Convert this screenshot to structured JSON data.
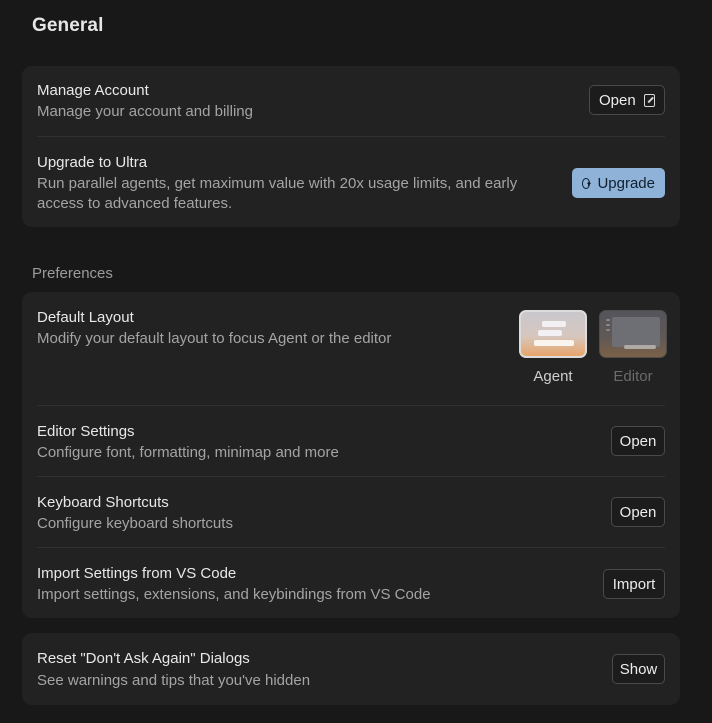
{
  "page_title": "General",
  "account": {
    "manage": {
      "title": "Manage Account",
      "description": "Manage your account and billing",
      "button_label": "Open",
      "button_icon": "external-link-icon"
    },
    "upgrade": {
      "title": "Upgrade to Ultra",
      "description": "Run parallel agents, get maximum value with 20x usage limits, and early access to advanced features.",
      "button_label": "Upgrade",
      "button_icon": "arrow-up-circle-icon",
      "button_color": "#8fb2d8"
    }
  },
  "preferences": {
    "section_label": "Preferences",
    "default_layout": {
      "title": "Default Layout",
      "description": "Modify your default layout to focus Agent or the editor",
      "options": [
        {
          "label": "Agent",
          "selected": true
        },
        {
          "label": "Editor",
          "selected": false
        }
      ]
    },
    "editor_settings": {
      "title": "Editor Settings",
      "description": "Configure font, formatting, minimap and more",
      "button_label": "Open"
    },
    "keyboard_shortcuts": {
      "title": "Keyboard Shortcuts",
      "description": "Configure keyboard shortcuts",
      "button_label": "Open"
    },
    "import_vscode": {
      "title": "Import Settings from VS Code",
      "description": "Import settings, extensions, and keybindings from VS Code",
      "button_label": "Import"
    }
  },
  "dialogs": {
    "reset": {
      "title": "Reset \"Don't Ask Again\" Dialogs",
      "description": "See warnings and tips that you've hidden",
      "button_label": "Show"
    }
  }
}
